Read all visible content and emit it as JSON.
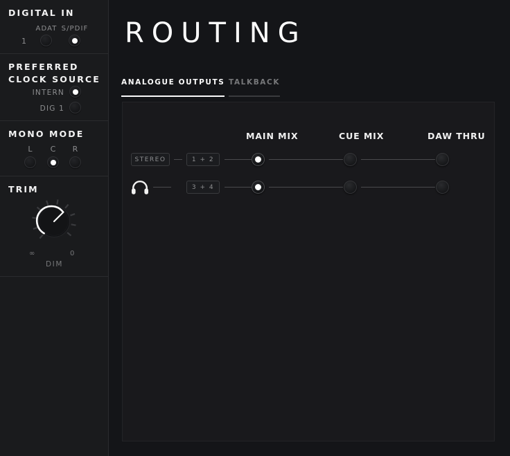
{
  "window": {
    "background": "#111214",
    "accent": "#ffffff"
  },
  "sidebar": {
    "sections": [
      {
        "title": "DIGITAL IN",
        "row_label": "1",
        "options": [
          {
            "label": "ADAT",
            "selected": false
          },
          {
            "label": "S/PDIF",
            "selected": true
          }
        ]
      },
      {
        "title": "PREFERRED\nCLOCK SOURCE",
        "options": [
          {
            "label": "INTERN",
            "selected": true
          },
          {
            "label": "DIG 1",
            "selected": false
          }
        ]
      },
      {
        "title": "MONO MODE",
        "options": [
          {
            "label": "L",
            "selected": false
          },
          {
            "label": "C",
            "selected": true
          },
          {
            "label": "R",
            "selected": false
          }
        ]
      },
      {
        "title": "TRIM",
        "knob": {
          "min_label": "∞",
          "max_label": "0",
          "caption": "DIM",
          "value_angle": 35
        }
      }
    ]
  },
  "main": {
    "title": "ROUTING",
    "tabs": [
      {
        "label": "ANALOGUE OUTPUTS",
        "active": true
      },
      {
        "label": "TALKBACK",
        "active": false
      }
    ],
    "columns": [
      {
        "label": "MAIN MIX"
      },
      {
        "label": "CUE MIX"
      },
      {
        "label": "DAW THRU"
      }
    ],
    "rows": [
      {
        "source_icon": "speaker-stereo-label",
        "source_label": "STEREO",
        "channel_label": "1 + 2",
        "selected_column": "MAIN MIX"
      },
      {
        "source_icon": "headphones-icon",
        "source_label": "",
        "channel_label": "3 + 4",
        "selected_column": "MAIN MIX"
      }
    ]
  }
}
